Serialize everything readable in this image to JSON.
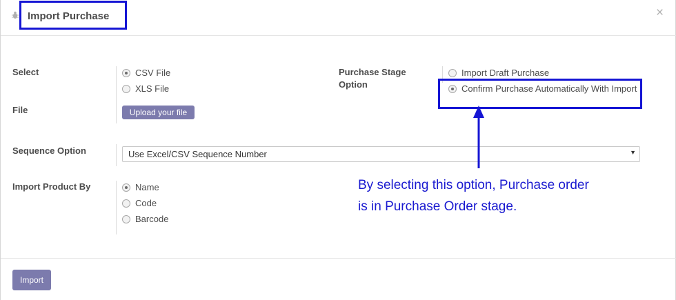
{
  "header": {
    "title": "Import Purchase",
    "close_glyph": "×"
  },
  "select_section": {
    "label": "Select",
    "options": [
      {
        "label": "CSV File",
        "checked": true
      },
      {
        "label": "XLS File",
        "checked": false
      }
    ]
  },
  "file_section": {
    "label": "File",
    "upload_label": "Upload your file"
  },
  "stage_section": {
    "label_line1": "Purchase Stage",
    "label_line2": "Option",
    "options": [
      {
        "label": "Import Draft Purchase",
        "checked": false
      },
      {
        "label": "Confirm Purchase Automatically With Import",
        "checked": true
      }
    ]
  },
  "sequence_section": {
    "label": "Sequence Option",
    "selected": "Use Excel/CSV Sequence Number"
  },
  "product_section": {
    "label": "Import Product By",
    "options": [
      {
        "label": "Name",
        "checked": true
      },
      {
        "label": "Code",
        "checked": false
      },
      {
        "label": "Barcode",
        "checked": false
      }
    ]
  },
  "footer": {
    "import_label": "Import"
  },
  "annotation": {
    "line1": "By selecting this option, Purchase order",
    "line2": "is in Purchase Order stage.",
    "color": "#1a1ad0"
  }
}
